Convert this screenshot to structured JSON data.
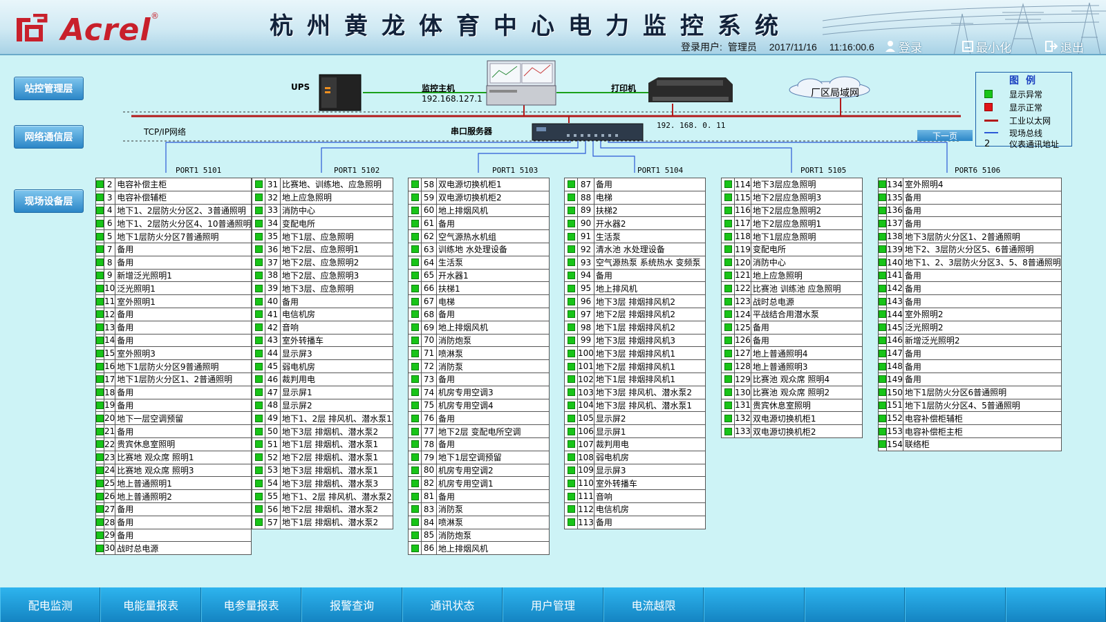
{
  "header": {
    "logo_text": "Acrel",
    "logo_reg": "®",
    "title": "杭州黄龙体育中心电力监控系统",
    "login_user_label": "登录用户:",
    "login_user": "管理员",
    "date": "2017/11/16",
    "time": "11:16:00.6",
    "login_button": "登录",
    "minimize_button": "最小化",
    "exit_button": "退出"
  },
  "layers": {
    "station": "站控管理层",
    "network": "网络通信层",
    "field": "现场设备层"
  },
  "topology": {
    "ups": "UPS",
    "host": "监控主机",
    "host_ip": "192.168.127.1",
    "printer": "打印机",
    "lan": "厂区局域网",
    "tcpip": "TCP/IP网络",
    "serial_server": "串口服务器",
    "lan_ip": "192. 168. 0. 11"
  },
  "legend": {
    "title": "图例",
    "items": [
      {
        "label": "显示异常",
        "color": "#18c418"
      },
      {
        "label": "显示正常",
        "color": "#e0141a"
      },
      {
        "label": "工业以太网",
        "color": "#b21a1a"
      },
      {
        "label": "现场总线",
        "color": "#2b59d6"
      },
      {
        "label": "仪表通讯地址",
        "symbol": "2"
      }
    ]
  },
  "next_page": "下一页",
  "ports": [
    {
      "label": "PORT1 5101",
      "rows": [
        [
          "2",
          "电容补偿主柜"
        ],
        [
          "3",
          "电容补偿辅柜"
        ],
        [
          "4",
          "地下1、2层防火分区2、3普通照明"
        ],
        [
          "6",
          "地下1、2层防火分区4、10普通照明"
        ],
        [
          "5",
          "地下1层防火分区7普通照明"
        ],
        [
          "7",
          "备用"
        ],
        [
          "8",
          "备用"
        ],
        [
          "9",
          "新增泛光照明1"
        ],
        [
          "10",
          "泛光照明1"
        ],
        [
          "11",
          "室外照明1"
        ],
        [
          "12",
          "备用"
        ],
        [
          "13",
          "备用"
        ],
        [
          "14",
          "备用"
        ],
        [
          "15",
          "室外照明3"
        ],
        [
          "16",
          "地下1层防火分区9普通照明"
        ],
        [
          "17",
          "地下1层防火分区1、2普通照明"
        ],
        [
          "18",
          "备用"
        ],
        [
          "19",
          "备用"
        ],
        [
          "20",
          "地下一层空调预留"
        ],
        [
          "21",
          "备用"
        ],
        [
          "22",
          "贵宾休息室照明"
        ],
        [
          "23",
          "比赛地 观众席 照明1"
        ],
        [
          "24",
          "比赛地 观众席 照明3"
        ],
        [
          "25",
          "地上普通照明1"
        ],
        [
          "26",
          "地上普通照明2"
        ],
        [
          "27",
          "备用"
        ],
        [
          "28",
          "备用"
        ],
        [
          "29",
          "备用"
        ],
        [
          "30",
          "战时总电源"
        ]
      ]
    },
    {
      "label": "PORT1 5102",
      "rows": [
        [
          "31",
          "比赛地、训练地、应急照明"
        ],
        [
          "32",
          "地上应急照明"
        ],
        [
          "33",
          "消防中心"
        ],
        [
          "34",
          "变配电所"
        ],
        [
          "35",
          "地下1层、应急照明"
        ],
        [
          "36",
          "地下2层、应急照明1"
        ],
        [
          "37",
          "地下2层、应急照明2"
        ],
        [
          "38",
          "地下2层、应急照明3"
        ],
        [
          "39",
          "地下3层、应急照明"
        ],
        [
          "40",
          "备用"
        ],
        [
          "41",
          "电信机房"
        ],
        [
          "42",
          "音响"
        ],
        [
          "43",
          "室外转播车"
        ],
        [
          "44",
          "显示屏3"
        ],
        [
          "45",
          "弱电机房"
        ],
        [
          "46",
          "裁判用电"
        ],
        [
          "47",
          "显示屏1"
        ],
        [
          "48",
          "显示屏2"
        ],
        [
          "49",
          "地下1、2层 排风机、潜水泵1"
        ],
        [
          "50",
          "地下3层 排烟机、潜水泵2"
        ],
        [
          "51",
          "地下1层 排烟机、潜水泵1"
        ],
        [
          "52",
          "地下2层 排烟机、潜水泵1"
        ],
        [
          "53",
          "地下3层 排烟机、潜水泵1"
        ],
        [
          "54",
          "地下3层 排烟机、潜水泵3"
        ],
        [
          "55",
          "地下1、2层 排风机、潜水泵2"
        ],
        [
          "56",
          "地下2层 排烟机、潜水泵2"
        ],
        [
          "57",
          "地下1层 排烟机、潜水泵2"
        ]
      ]
    },
    {
      "label": "PORT1 5103",
      "rows": [
        [
          "58",
          "双电源切换机柜1"
        ],
        [
          "59",
          "双电源切换机柜2"
        ],
        [
          "60",
          "地上排烟风机"
        ],
        [
          "61",
          "备用"
        ],
        [
          "62",
          "空气源热水机组"
        ],
        [
          "63",
          "训练地 水处理设备"
        ],
        [
          "64",
          "生活泵"
        ],
        [
          "65",
          "开水器1"
        ],
        [
          "66",
          "扶梯1"
        ],
        [
          "67",
          "电梯"
        ],
        [
          "68",
          "备用"
        ],
        [
          "69",
          "地上排烟风机"
        ],
        [
          "70",
          "消防炮泵"
        ],
        [
          "71",
          "喷淋泵"
        ],
        [
          "72",
          "消防泵"
        ],
        [
          "73",
          "备用"
        ],
        [
          "74",
          "机房专用空调3"
        ],
        [
          "75",
          "机房专用空调4"
        ],
        [
          "76",
          "备用"
        ],
        [
          "77",
          "地下2层 变配电所空调"
        ],
        [
          "78",
          "备用"
        ],
        [
          "79",
          "地下1层空调预留"
        ],
        [
          "80",
          "机房专用空调2"
        ],
        [
          "82",
          "机房专用空调1"
        ],
        [
          "81",
          "备用"
        ],
        [
          "83",
          "消防泵"
        ],
        [
          "84",
          "喷淋泵"
        ],
        [
          "85",
          "消防炮泵"
        ],
        [
          "86",
          "地上排烟风机"
        ]
      ]
    },
    {
      "label": "PORT1 5104",
      "rows": [
        [
          "87",
          "备用"
        ],
        [
          "88",
          "电梯"
        ],
        [
          "89",
          "扶梯2"
        ],
        [
          "90",
          "开水器2"
        ],
        [
          "91",
          "生活泵"
        ],
        [
          "92",
          "清水池 水处理设备"
        ],
        [
          "93",
          "空气源热泵 系统热水 变频泵"
        ],
        [
          "94",
          "备用"
        ],
        [
          "95",
          "地上排风机"
        ],
        [
          "96",
          "地下3层 排烟排风机2"
        ],
        [
          "97",
          "地下2层 排烟排风机2"
        ],
        [
          "98",
          "地下1层 排烟排风机2"
        ],
        [
          "99",
          "地下3层 排烟排风机3"
        ],
        [
          "100",
          "地下3层 排烟排风机1"
        ],
        [
          "101",
          "地下2层 排烟排风机1"
        ],
        [
          "102",
          "地下1层 排烟排风机1"
        ],
        [
          "103",
          "地下3层 排风机、潜水泵2"
        ],
        [
          "104",
          "地下3层 排风机、潜水泵1"
        ],
        [
          "105",
          "显示屏2"
        ],
        [
          "106",
          "显示屏1"
        ],
        [
          "107",
          "裁判用电"
        ],
        [
          "108",
          "弱电机房"
        ],
        [
          "109",
          "显示屏3"
        ],
        [
          "110",
          "室外转播车"
        ],
        [
          "111",
          "音响"
        ],
        [
          "112",
          "电信机房"
        ],
        [
          "113",
          "备用"
        ]
      ]
    },
    {
      "label": "PORT1 5105",
      "rows": [
        [
          "114",
          "地下3层应急照明"
        ],
        [
          "115",
          "地下2层应急照明3"
        ],
        [
          "116",
          "地下2层应急照明2"
        ],
        [
          "117",
          "地下2层应急照明1"
        ],
        [
          "118",
          "地下1层应急照明"
        ],
        [
          "119",
          "变配电所"
        ],
        [
          "120",
          "消防中心"
        ],
        [
          "121",
          "地上应急照明"
        ],
        [
          "122",
          "比赛池 训练池 应急照明"
        ],
        [
          "123",
          "战时总电源"
        ],
        [
          "124",
          "平战结合用潜水泵"
        ],
        [
          "125",
          "备用"
        ],
        [
          "126",
          "备用"
        ],
        [
          "127",
          "地上普通照明4"
        ],
        [
          "128",
          "地上普通照明3"
        ],
        [
          "129",
          "比赛池 观众席 照明4"
        ],
        [
          "130",
          "比赛池 观众席 照明2"
        ],
        [
          "131",
          "贵宾休息室照明"
        ],
        [
          "132",
          "双电源切换机柜1"
        ],
        [
          "133",
          "双电源切换机柜2"
        ]
      ]
    },
    {
      "label": "PORT6 5106",
      "rows": [
        [
          "134",
          "室外照明4"
        ],
        [
          "135",
          "备用"
        ],
        [
          "136",
          "备用"
        ],
        [
          "137",
          "备用"
        ],
        [
          "138",
          "地下3层防火分区1、2普通照明"
        ],
        [
          "139",
          "地下2、3层防火分区5、6普通照明"
        ],
        [
          "140",
          "地下1、2、3层防火分区3、5、8普通照明"
        ],
        [
          "141",
          "备用"
        ],
        [
          "142",
          "备用"
        ],
        [
          "143",
          "备用"
        ],
        [
          "144",
          "室外照明2"
        ],
        [
          "145",
          "泛光照明2"
        ],
        [
          "146",
          "新增泛光照明2"
        ],
        [
          "147",
          "备用"
        ],
        [
          "148",
          "备用"
        ],
        [
          "149",
          "备用"
        ],
        [
          "150",
          "地下1层防火分区6普通照明"
        ],
        [
          "151",
          "地下1层防火分区4、5普通照明"
        ],
        [
          "152",
          "电容补偿柜辅柜"
        ],
        [
          "153",
          "电容补偿柜主柜"
        ],
        [
          "154",
          "联络柜"
        ]
      ]
    }
  ],
  "footer": {
    "tabs": [
      "配电监测",
      "电能量报表",
      "电参量报表",
      "报警查询",
      "通讯状态",
      "用户管理",
      "电流越限",
      "",
      "",
      "",
      ""
    ]
  }
}
